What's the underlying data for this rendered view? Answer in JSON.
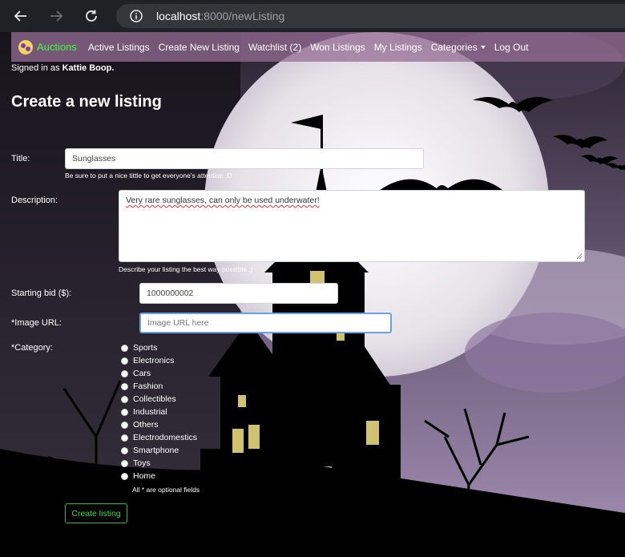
{
  "browser": {
    "url_host": "localhost",
    "url_rest": ":8000/newListing"
  },
  "navbar": {
    "brand": "Auctions",
    "links": [
      "Active Listings",
      "Create New Listing",
      "Watchlist (2)",
      "Won Listings",
      "My Listings",
      "Categories",
      "Log Out"
    ]
  },
  "user": {
    "signed_prefix": "Signed in as",
    "name": "Kattie Boop."
  },
  "page": {
    "title": "Create a new listing"
  },
  "form": {
    "title_label": "Title:",
    "title_value": "Sunglasses",
    "title_help": "Be sure to put a nice tittle to get everyone's attention :D",
    "desc_label": "Description:",
    "desc_value": "Very rare sunglasses, can only be used underwater!",
    "desc_help": "Describe your listing the best way possible ;)",
    "bid_label": "Starting bid ($):",
    "bid_value": "1000000002",
    "image_label": "*Image URL:",
    "image_placeholder": "Image URL here",
    "category_label": "*Category:",
    "categories": [
      "Sports",
      "Electronics",
      "Cars",
      "Fashion",
      "Collectibles",
      "Industrial",
      "Others",
      "Electrodomestics",
      "Smartphone",
      "Toys",
      "Home"
    ],
    "optional_note": "All * are optional fields",
    "submit": "Create listing"
  },
  "colors": {
    "navbar_bg": "#966e96",
    "brand_green": "#3cff3c",
    "button_green": "#2eb82e",
    "chrome_bg": "#202124"
  }
}
